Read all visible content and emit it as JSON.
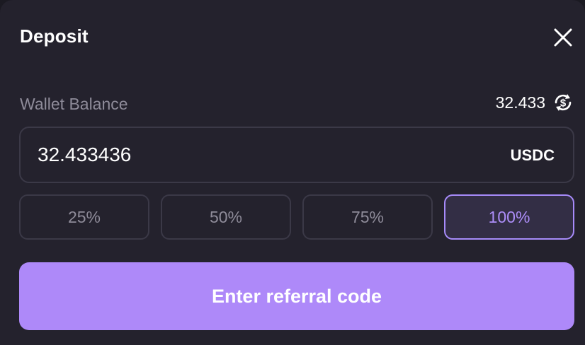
{
  "modal": {
    "title": "Deposit"
  },
  "wallet": {
    "label": "Wallet Balance",
    "balance": "32.433",
    "balance_icon": "dollar-refresh-icon"
  },
  "amount": {
    "value": "32.433436",
    "currency": "USDC"
  },
  "percent_buttons": [
    {
      "label": "25%",
      "active": false
    },
    {
      "label": "50%",
      "active": false
    },
    {
      "label": "75%",
      "active": false
    },
    {
      "label": "100%",
      "active": true
    }
  ],
  "cta": {
    "label": "Enter referral code"
  },
  "colors": {
    "background": "#24222d",
    "accent": "#ae89f9",
    "border": "#3b3947",
    "muted_text": "#8e8b99"
  }
}
